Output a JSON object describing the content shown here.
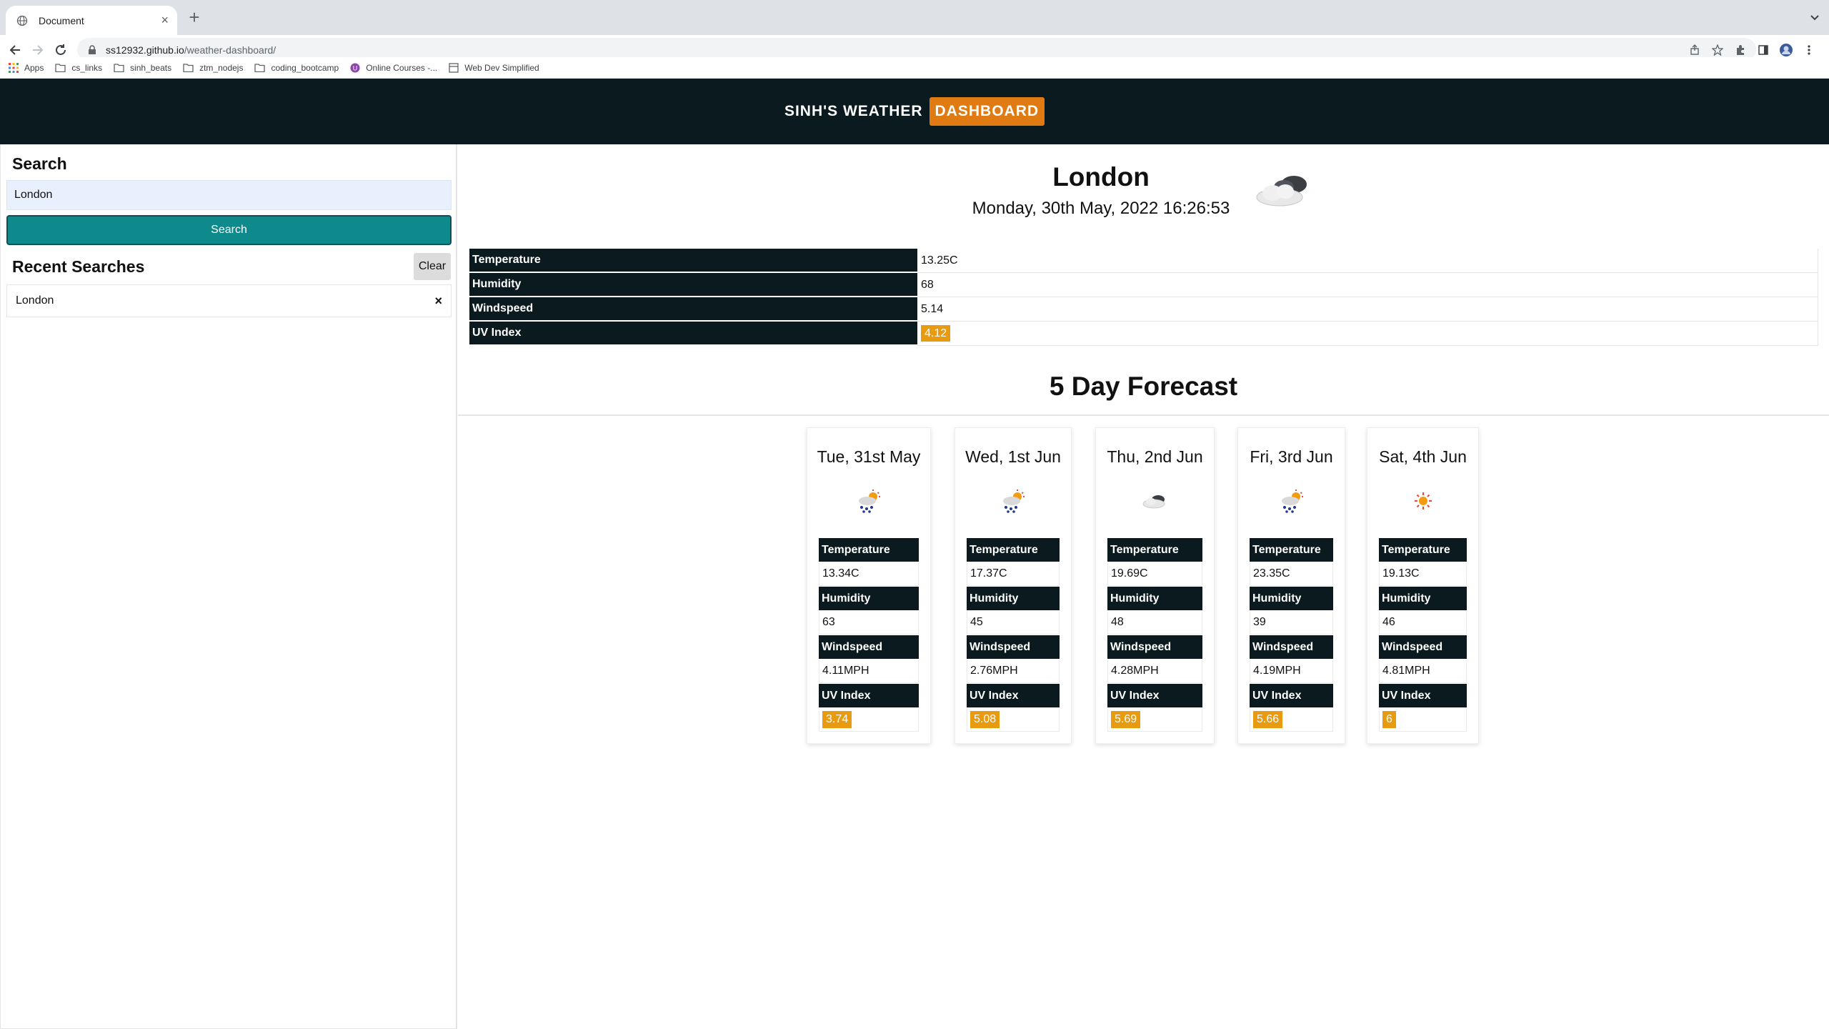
{
  "browser": {
    "tab_title": "Document",
    "url_host": "ss12932.github.io",
    "url_path": "/weather-dashboard/",
    "bookmarks": [
      "Apps",
      "cs_links",
      "sinh_beats",
      "ztm_nodejs",
      "coding_bootcamp",
      "Online Courses -...",
      "Web Dev Simplified"
    ]
  },
  "header": {
    "brand": "SINH'S WEATHER",
    "brand_accent": "DASHBOARD"
  },
  "sidebar": {
    "search_heading": "Search",
    "search_value": "London",
    "search_button": "Search",
    "recent_heading": "Recent Searches",
    "clear_button": "Clear",
    "recent_items": [
      {
        "label": "London",
        "remove": "×"
      }
    ]
  },
  "current": {
    "city": "London",
    "datetime": "Monday, 30th May, 2022 16:26:53",
    "icon": "cloudy-icon",
    "rows": [
      {
        "label": "Temperature",
        "value": "13.25C"
      },
      {
        "label": "Humidity",
        "value": "68"
      },
      {
        "label": "Windspeed",
        "value": "5.14"
      },
      {
        "label": "UV Index",
        "value": "4.12"
      }
    ]
  },
  "forecast": {
    "title": "5 Day Forecast",
    "labels": {
      "temperature": "Temperature",
      "humidity": "Humidity",
      "windspeed": "Windspeed",
      "uv": "UV Index"
    },
    "days": [
      {
        "date": "Tue, 31st May",
        "icon": "rain-sun-icon",
        "temperature": "13.34C",
        "humidity": "63",
        "windspeed": "4.11MPH",
        "uv": "3.74"
      },
      {
        "date": "Wed, 1st Jun",
        "icon": "rain-sun-icon",
        "temperature": "17.37C",
        "humidity": "45",
        "windspeed": "2.76MPH",
        "uv": "5.08"
      },
      {
        "date": "Thu, 2nd Jun",
        "icon": "cloud-icon",
        "temperature": "19.69C",
        "humidity": "48",
        "windspeed": "4.28MPH",
        "uv": "5.69"
      },
      {
        "date": "Fri, 3rd Jun",
        "icon": "rain-sun-icon",
        "temperature": "23.35C",
        "humidity": "39",
        "windspeed": "4.19MPH",
        "uv": "5.66"
      },
      {
        "date": "Sat, 4th Jun",
        "icon": "sun-icon",
        "temperature": "19.13C",
        "humidity": "46",
        "windspeed": "4.81MPH",
        "uv": "6"
      }
    ]
  },
  "colors": {
    "header_bg": "#0a1a1f",
    "accent": "#e07a12",
    "button": "#0f8a8c",
    "uv_badge": "#e89a10"
  }
}
